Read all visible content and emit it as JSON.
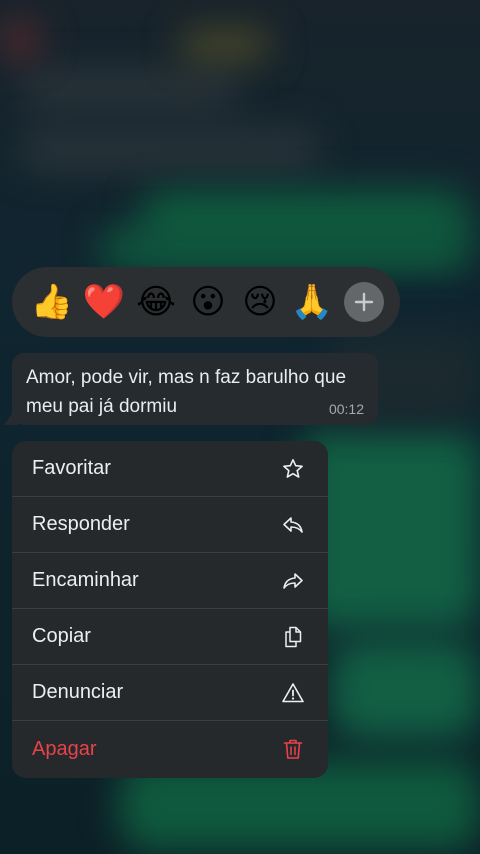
{
  "reactions": [
    {
      "emoji": "👍",
      "name": "thumbs-up"
    },
    {
      "emoji": "❤️",
      "name": "heart"
    },
    {
      "emoji": "😂",
      "name": "tears-of-joy"
    },
    {
      "emoji": "😮",
      "name": "surprised"
    },
    {
      "emoji": "😢",
      "name": "crying"
    },
    {
      "emoji": "🙏",
      "name": "folded-hands"
    }
  ],
  "message": {
    "text": "Amor, pode vir, mas n faz barulho que meu pai já dormiu",
    "time": "00:12"
  },
  "menu": {
    "items": [
      {
        "label": "Favoritar",
        "icon": "star-icon"
      },
      {
        "label": "Responder",
        "icon": "reply-icon"
      },
      {
        "label": "Encaminhar",
        "icon": "forward-icon"
      },
      {
        "label": "Copiar",
        "icon": "copy-icon"
      },
      {
        "label": "Denunciar",
        "icon": "warning-icon"
      },
      {
        "label": "Apagar",
        "icon": "trash-icon"
      }
    ]
  },
  "colors": {
    "danger": "#e8424a",
    "menu_bg": "#26292b",
    "bubble_bg": "#252b2f"
  }
}
